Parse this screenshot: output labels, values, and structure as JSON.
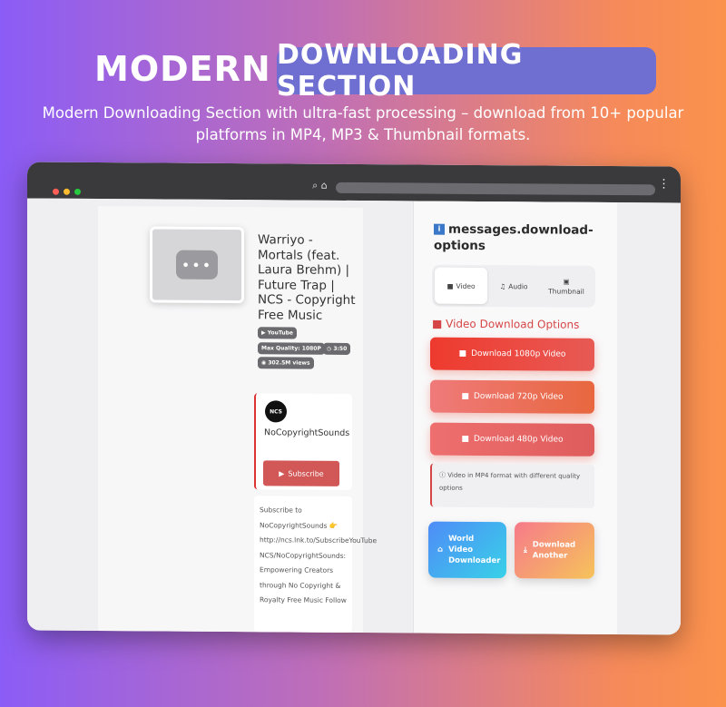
{
  "hero": {
    "title_word": "MODERN",
    "title_pill": "DOWNLOADING SECTION",
    "subtitle_line1": "Modern Downloading Section with ultra-fast processing – download from 10+ popular",
    "subtitle_line2": "platforms in MP4, MP3 & Thumbnail formats.",
    "colors": {
      "pill": "#6f6fd2",
      "gradient_start": "#8b5cf6",
      "gradient_end": "#fb924c"
    }
  },
  "browser": {
    "chrome_icons": [
      "search-icon",
      "home-icon",
      "site-settings-icon"
    ],
    "menu_icon": "kebab-menu-icon"
  },
  "video": {
    "title": "Warriyo - Mortals (feat. Laura Brehm) | Future Trap | NCS - Copyright Free Music",
    "platform": "YouTube",
    "max_quality": "Max Quality: 1080P",
    "duration": "3:50",
    "views": "302.5M views"
  },
  "channel": {
    "logo_text": "NCS",
    "name": "NoCopyrightSounds",
    "subscribe_label": "Subscribe"
  },
  "description": "Subscribe to NoCopyrightSounds 👉 http://ncs.lnk.to/SubscribeYouTube NCS/NoCopyrightSounds: Empowering Creators through No Copyright & Royalty Free Music Follow",
  "options": {
    "title": "messages.download-options",
    "tabs": [
      {
        "label": "Video",
        "icon": "video-camera-icon"
      },
      {
        "label": "Audio",
        "icon": "music-note-icon"
      },
      {
        "label": "Thumbnail",
        "icon": "image-icon"
      }
    ],
    "section_heading": "Video Download Options",
    "buttons": [
      "Download 1080p Video",
      "Download 720p Video",
      "Download 480p Video"
    ],
    "note": "Video in MP4 format with different quality options",
    "world_label": "World Video Downloader",
    "another_label": "Download Another",
    "accent": "#d64545"
  }
}
